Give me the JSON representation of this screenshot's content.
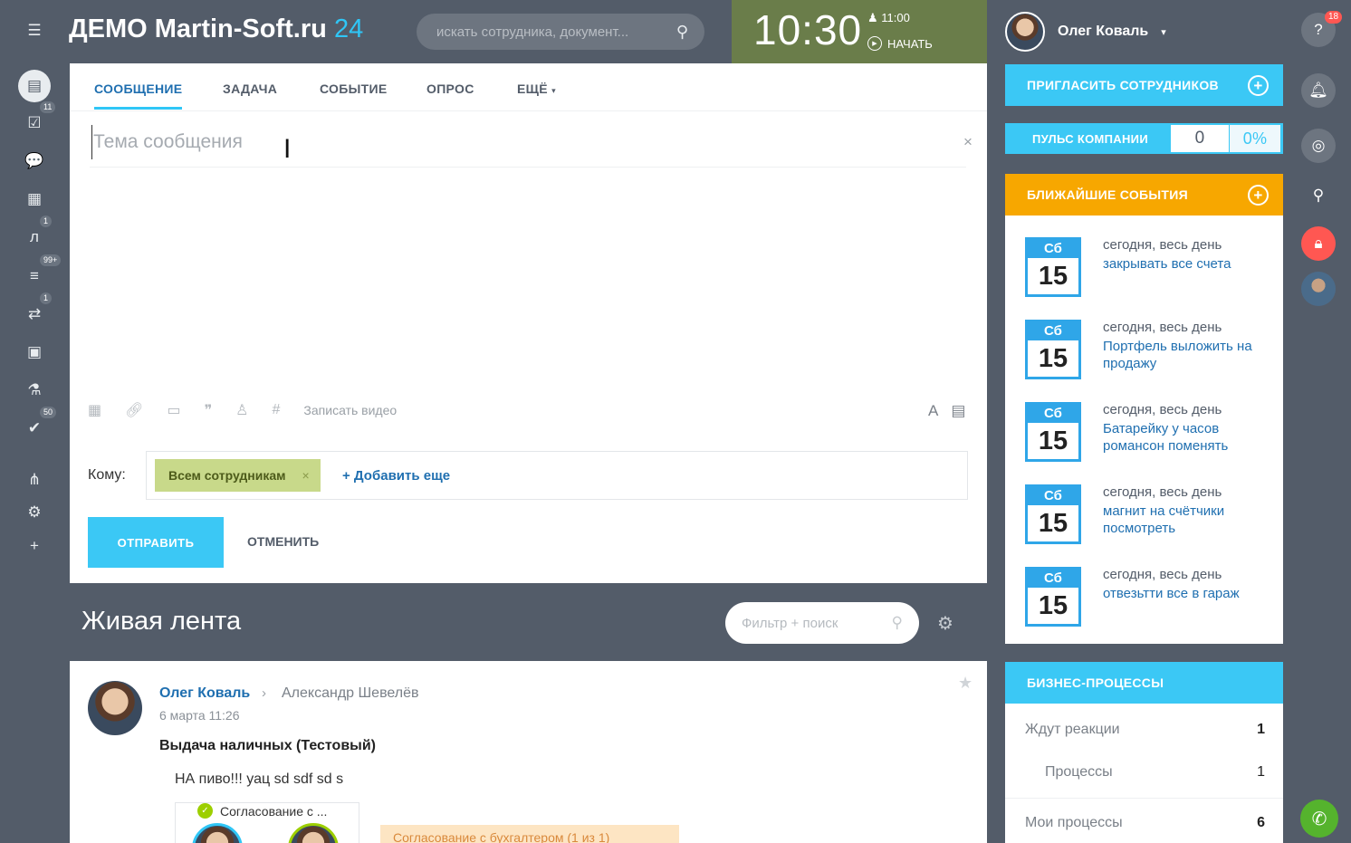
{
  "header": {
    "logo_text": "ДЕМО Martin-Soft.ru",
    "logo_num": "24",
    "search_placeholder": "искать сотрудника, документ...",
    "clock": "10:30",
    "alarm": "11:00",
    "start_label": "НАЧАТЬ",
    "user_name": "Олег Коваль"
  },
  "leftnav": {
    "badges": {
      "tasks": "11",
      "l": "1",
      "filter": "99+",
      "sync": "1",
      "check": "50"
    }
  },
  "right_icons": {
    "help_badge": "18"
  },
  "composer": {
    "tabs": [
      "СООБЩЕНИЕ",
      "ЗАДАЧА",
      "СОБЫТИЕ",
      "ОПРОС",
      "ЕЩЁ"
    ],
    "subject_placeholder": "Тема сообщения",
    "record_video": "Записать видео",
    "to_label": "Кому:",
    "recipient": "Всем сотрудникам",
    "add_more": "+ Добавить еще",
    "send": "ОТПРАВИТЬ",
    "cancel": "ОТМЕНИТЬ"
  },
  "feed": {
    "title": "Живая лента",
    "filter_placeholder": "Фильтр + поиск",
    "post": {
      "author": "Олег Коваль",
      "recipient": "Александр Шевелёв",
      "date": "6 марта 11:26",
      "title": "Выдача наличных (Тестовый)",
      "text": "НА пиво!!! уац sd sdf sd s",
      "approval_label": "Согласование с ...",
      "notice": "Согласование с бухгалтером (1 из 1)"
    }
  },
  "sidebar": {
    "invite": "ПРИГЛАСИТЬ СОТРУДНИКОВ",
    "pulse": {
      "label": "ПУЛЬС КОМПАНИИ",
      "value": "0",
      "percent": "0%"
    },
    "events_title": "БЛИЖАЙШИЕ СОБЫТИЯ",
    "events": [
      {
        "dow": "Сб",
        "day": "15",
        "when": "сегодня, весь день",
        "what": "закрывать все счета"
      },
      {
        "dow": "Сб",
        "day": "15",
        "when": "сегодня, весь день",
        "what": "Портфель выложить на продажу"
      },
      {
        "dow": "Сб",
        "day": "15",
        "when": "сегодня, весь день",
        "what": "Батарейку у часов романсон поменять"
      },
      {
        "dow": "Сб",
        "day": "15",
        "when": "сегодня, весь день",
        "what": "магнит на счётчики посмотреть"
      },
      {
        "dow": "Сб",
        "day": "15",
        "when": "сегодня, весь день",
        "what": "отвезьтти все в гараж"
      }
    ],
    "bp_title": "БИЗНЕС-ПРОЦЕССЫ",
    "bp_rows": [
      {
        "label": "Ждут реакции",
        "count": "1"
      },
      {
        "label": "Процессы",
        "count": "1"
      },
      {
        "label": "Мои процессы",
        "count": "6"
      }
    ]
  }
}
